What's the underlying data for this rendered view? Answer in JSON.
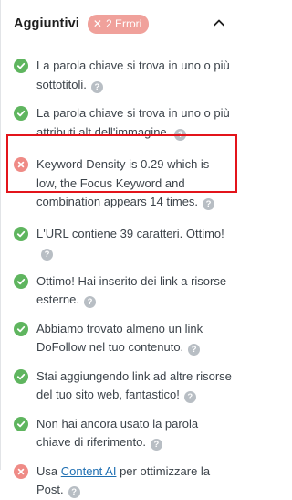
{
  "section": {
    "title": "Aggiuntivi",
    "badge": "2 Errori",
    "collapse_icon": "chevron-up-icon"
  },
  "checks": [
    {
      "status": "ok",
      "text": "La parola chiave si trova in uno o più sottotitoli."
    },
    {
      "status": "ok",
      "text": "La parola chiave si trova in uno o più attributi alt dell'immagine."
    },
    {
      "status": "error",
      "text": "Keyword Density is 0.29 which is low, the Focus Keyword and combination appears 14 times.",
      "highlighted": true
    },
    {
      "status": "ok",
      "text": "L'URL contiene 39 caratteri. Ottimo!"
    },
    {
      "status": "ok",
      "text": "Ottimo! Hai inserito dei link a risorse esterne."
    },
    {
      "status": "ok",
      "text": "Abbiamo trovato almeno un link DoFollow nel tuo contenuto."
    },
    {
      "status": "ok",
      "text": "Stai aggiungendo link ad altre risorse del tuo sito web, fantastico!"
    },
    {
      "status": "ok",
      "text": "Non hai ancora usato la parola chiave di riferimento."
    },
    {
      "status": "error",
      "text_before": "Usa ",
      "link": "Content AI",
      "text_after": " per ottimizzare la Post."
    }
  ],
  "help_glyph": "?",
  "colors": {
    "ok": "#5fb55f",
    "error": "#ef8b86",
    "badge": "#f0a19b",
    "highlight": "#e3141b",
    "link": "#1f6fb2"
  }
}
